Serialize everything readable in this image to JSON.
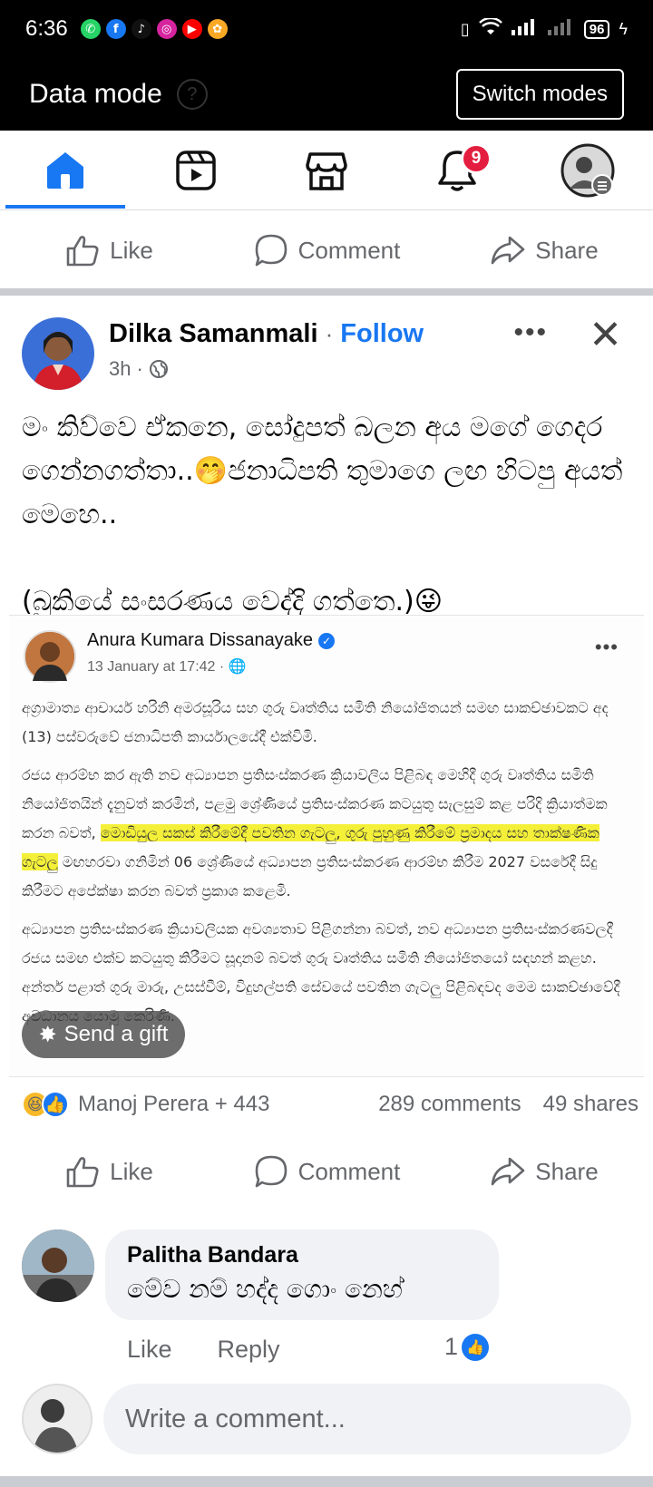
{
  "status_bar": {
    "time": "6:36",
    "battery": "96",
    "apps": [
      {
        "icon": "whatsapp-icon",
        "glyph": "✆",
        "color": "#25d366"
      },
      {
        "icon": "facebook-icon",
        "glyph": "f",
        "color": "#1877f2"
      },
      {
        "icon": "tiktok-icon",
        "glyph": "♪",
        "color": "#111111"
      },
      {
        "icon": "instagram-icon",
        "glyph": "◎",
        "color": "#d6249f"
      },
      {
        "icon": "youtube-icon",
        "glyph": "▶",
        "color": "#ff0000"
      },
      {
        "icon": "app-icon",
        "glyph": "✿",
        "color": "#f9a825"
      }
    ]
  },
  "data_mode": {
    "title": "Data mode",
    "switch_label": "Switch modes"
  },
  "nav": {
    "notification_count": "9",
    "accent": "#1877f2"
  },
  "actions": {
    "like": "Like",
    "comment": "Comment",
    "share": "Share"
  },
  "post": {
    "author": "Dilka Samanmali",
    "separator": "·",
    "follow": "Follow",
    "time": "3h",
    "text_line1": "මං කිව්වෙ ඒකනෙ, සෝදුපත් බලන අය මගේ ගෙදර ගෙන්නගත්තා..🤭ජනාධිපති තුමාගෙ ලඟ හිටපු අයත් මෙහෙ..",
    "text_line2": "(බුකියේ සංසරණය වෙද්දි ගත්තෙ.)😜"
  },
  "shared": {
    "author": "Anura Kumara Dissanayake",
    "time": "13 January at 17:42 · ",
    "para1": "අග්‍රාමාත්‍ය ආචාර්ය හරිනි අමරසූරිය සහ ගුරු වෘත්තිය සමිති නියෝජිතයන් සමඟ සාකච්ඡාවකට අද (13) පස්වරුවේ ජනාධිපති කාර්යාලයේදී එක්විමි.",
    "para2a": "රජය ආරම්භ කර ඇති නව අධ්‍යාපන ප්‍රතිසංස්කරණ ක්‍රියාවලිය පිළිබඳ මෙහිදී ගුරු වෘත්තිය සමිති නියෝජිතයින් දැනුවත් කරමින්, පළමු ශ්‍රේණියේ ප්‍රතිසංස්කරණ කටයුතු සැලසුම් කළ පරිදි ක්‍රියාත්මක කරන බවත්, ",
    "para2hl": "මොඩියුල සකස් කිරීමේදී පවතින ගැටලු, ගුරු පුහුණු කිරීමේ ප්‍රමාදය සහ තාක්ෂණික ගැටලු",
    "para2b": " මඟහරවා ගනිමින් 06 ශ්‍රේණියේ අධ්‍යාපන ප්‍රතිසංස්කරණ ආරම්භ කිරීම 2027 වසරේදී සිදු කිරීමට අපේක්ෂා කරන බවත් ප්‍රකාශ කළෙමි.",
    "para3": "අධ්‍යාපන ප්‍රතිසංස්කරණ ක්‍රියාවලියක අවශ්‍යතාව පිළිගන්නා බවත්, නව අධ්‍යාපන ප්‍රතිසංස්කරණවලදී රජය සමඟ එක්ව කටයුතු කිරීමට සූදානම් බවත් ගුරු වෘත්තිය සමිති නියෝජිතයෝ සඳහන් කළහ. අන්තර් පළාත් ගුරු මාරු, උසස්වීම්, විදුහල්පති සේවයේ පවතින ගැටලු පිළිබඳවද මෙම සාකච්ඡාවේදී අවධානය යොමු කෙරිණි.",
    "gift_label": "Send a gift"
  },
  "reactions": {
    "names": "Manoj Perera + 443",
    "comments": "289 comments",
    "shares": "49 shares"
  },
  "comment": {
    "author": "Palitha Bandara",
    "text": "මේව නම් හද්ද ගොං නෙහ්",
    "like": "Like",
    "reply": "Reply",
    "likes": "1"
  },
  "composer": {
    "placeholder": "Write a comment..."
  }
}
